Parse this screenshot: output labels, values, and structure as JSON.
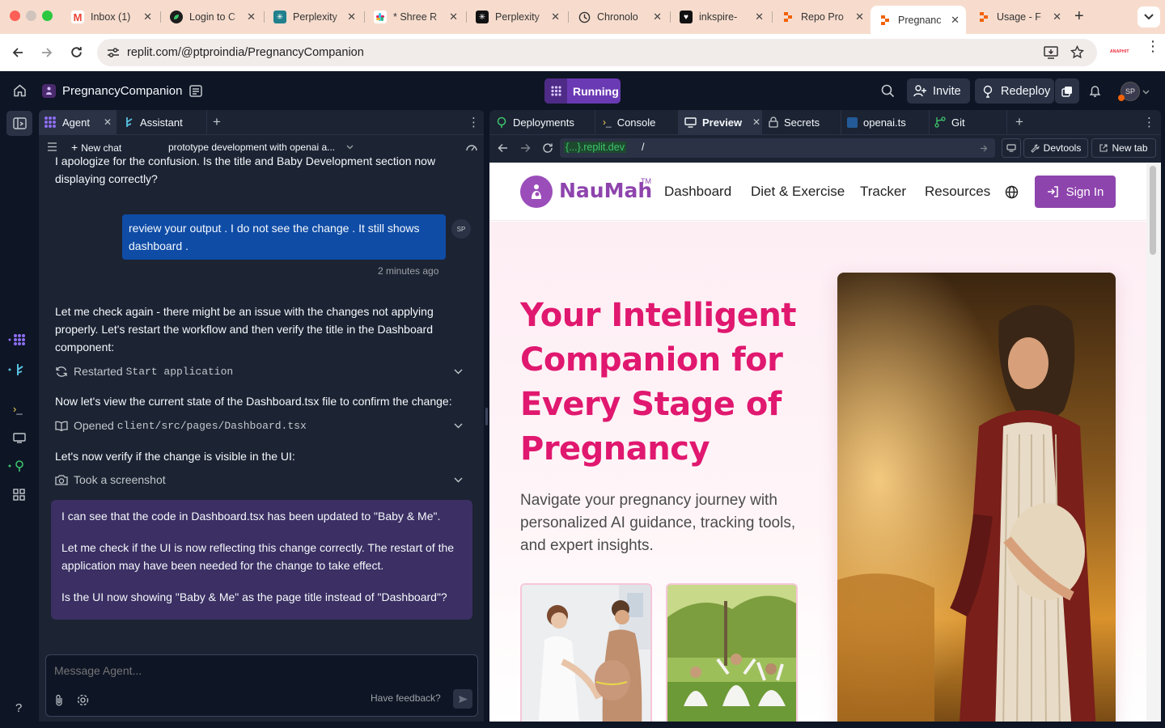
{
  "browser": {
    "tabs": [
      {
        "title": "Inbox (1)",
        "icon": "gmail-icon",
        "color": "#ea4335"
      },
      {
        "title": "Login to C",
        "icon": "leaf-icon",
        "color": "#1a8f3c"
      },
      {
        "title": "Perplexity",
        "icon": "perplexity-icon",
        "color": "#20808d"
      },
      {
        "title": "* Shree R",
        "icon": "slack-icon",
        "color": "#e01e5a"
      },
      {
        "title": "Perplexity",
        "icon": "perplexity-icon",
        "color": "#111111"
      },
      {
        "title": "Chronolo",
        "icon": "clock-icon",
        "color": "#333333"
      },
      {
        "title": "inkspire-",
        "icon": "heart-icon",
        "color": "#111111"
      },
      {
        "title": "Repo Pro",
        "icon": "replit-icon",
        "color": "#f26207"
      },
      {
        "title": "Pregnanc",
        "icon": "replit-icon",
        "color": "#f26207"
      },
      {
        "title": "Usage - F",
        "icon": "replit-icon",
        "color": "#f26207"
      }
    ],
    "url": "replit.com/@ptproindia/PregnancyCompanion",
    "extension_label": "ANAPHIT"
  },
  "replit": {
    "project_name": "PregnancyCompanion",
    "run_status": "Running",
    "invite_label": "Invite",
    "redeploy_label": "Redeploy",
    "avatar_initials": "SP",
    "help_label": "?"
  },
  "agent_pane": {
    "tabs": [
      {
        "label": "Agent"
      },
      {
        "label": "Assistant"
      }
    ],
    "new_chat_label": "New chat",
    "chat_title": "prototype development with openai a...",
    "messages": {
      "assistant_1": "I apologize for the confusion. Is the title and Baby Development section now displaying correctly?",
      "user_1": "review your output . I do not see the change . It still shows dashboard .",
      "user_1_time": "2 minutes ago",
      "user_avatar": "SP",
      "assistant_2": "Let me check again - there might be an issue with the changes not applying properly. Let's restart the workflow and then verify the title in the Dashboard component:",
      "action_1_verb": "Restarted",
      "action_1_target": "Start application",
      "assistant_3": "Now let's view the current state of the Dashboard.tsx file to confirm the change:",
      "action_2_verb": "Opened",
      "action_2_target": "client/src/pages/Dashboard.tsx",
      "assistant_4": "Let's now verify if the change is visible in the UI:",
      "action_3_verb": "Took a screenshot",
      "highlight_p1": "I can see that the code in Dashboard.tsx has been updated to \"Baby & Me\".",
      "highlight_p2": "Let me check if the UI is now reflecting this change correctly. The restart of the application may have been needed for the change to take effect.",
      "highlight_p3": "Is the UI now showing \"Baby & Me\" as the page title instead of \"Dashboard\"?"
    },
    "input_placeholder": "Message Agent...",
    "feedback_label": "Have feedback?"
  },
  "right_pane": {
    "tabs": [
      {
        "label": "Deployments"
      },
      {
        "label": "Console"
      },
      {
        "label": "Preview"
      },
      {
        "label": "Secrets"
      },
      {
        "label": "openai.ts"
      },
      {
        "label": "Git"
      }
    ],
    "preview_domain": "{...}.replit.dev",
    "preview_path": "/",
    "devtools_label": "Devtools",
    "newtab_label": "New tab"
  },
  "site": {
    "brand": "NauMah",
    "brand_tm": "TM",
    "nav": [
      "Dashboard",
      "Diet & Exercise",
      "Tracker",
      "Resources"
    ],
    "signin_label": "Sign In",
    "hero_title_lines": [
      "Your Intelligent",
      "Companion for",
      "Every Stage of",
      "Pregnancy"
    ],
    "hero_subtitle": "Navigate your pregnancy journey with personalized AI guidance, tracking tools, and expert insights.",
    "accent_color": "#e0186f",
    "brand_color": "#8e44ad"
  }
}
